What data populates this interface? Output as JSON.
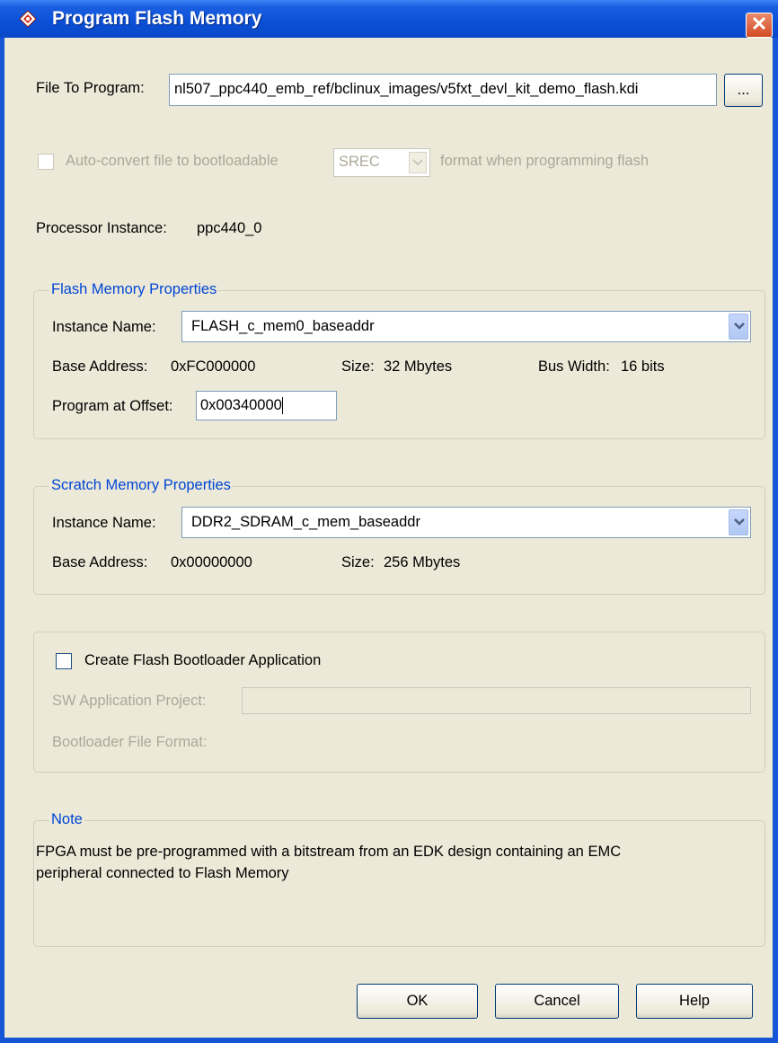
{
  "window": {
    "title": "Program Flash Memory",
    "close_label": "✕"
  },
  "file": {
    "label": "File To Program:",
    "value": "nl507_ppc440_emb_ref/bclinux_images/v5fxt_devl_kit_demo_flash.kdi",
    "browse_label": "..."
  },
  "autoconvert": {
    "label": "Auto-convert file to bootloadable",
    "format_value": "SREC",
    "suffix": "format when programming flash",
    "checked": false,
    "enabled": false
  },
  "processor": {
    "label": "Processor Instance:",
    "value": "ppc440_0"
  },
  "flash": {
    "group_title": "Flash Memory Properties",
    "instance_label": "Instance Name:",
    "instance_value": "FLASH_c_mem0_baseaddr",
    "base_label": "Base Address:",
    "base_value": "0xFC000000",
    "size_label": "Size:",
    "size_value": "32 Mbytes",
    "bus_label": "Bus Width:",
    "bus_value": "16 bits",
    "offset_label": "Program at Offset:",
    "offset_value": "0x00340000"
  },
  "scratch": {
    "group_title": "Scratch Memory Properties",
    "instance_label": "Instance Name:",
    "instance_value": "DDR2_SDRAM_c_mem_baseaddr",
    "base_label": "Base Address:",
    "base_value": "0x00000000",
    "size_label": "Size:",
    "size_value": "256 Mbytes"
  },
  "bootloader": {
    "checkbox_label": "Create Flash Bootloader Application",
    "checked": false,
    "project_label": "SW Application Project:",
    "project_value": "",
    "format_label": "Bootloader File Format:"
  },
  "note": {
    "group_title": "Note",
    "line1": "FPGA must be pre-programmed with a bitstream from an EDK design containing an EMC",
    "line2": "peripheral connected to Flash Memory"
  },
  "buttons": {
    "ok": "OK",
    "cancel": "Cancel",
    "help": "Help"
  },
  "colors": {
    "titlebar": "#0b4fd6",
    "dialog_bg": "#ece9d8",
    "group_title": "#0046d5",
    "disabled_text": "#aca899",
    "field_border": "#7f9db9"
  }
}
